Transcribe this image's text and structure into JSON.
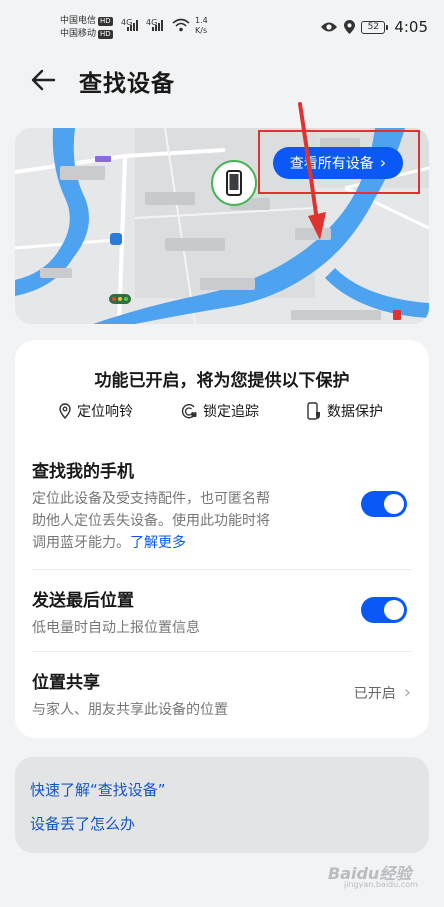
{
  "status_bar": {
    "carrier_1": "中国电信",
    "carrier_2": "中国移动",
    "hd": "HD",
    "network_1": "4G",
    "network_2": "4G",
    "speed_value": "1.4",
    "speed_unit": "K/s",
    "battery": "52",
    "time": "4:05"
  },
  "header": {
    "title": "查找设备"
  },
  "map": {
    "view_all_label": "查看所有设备"
  },
  "protection": {
    "heading": "功能已开启，将为您提供以下保护",
    "features": [
      {
        "label": "定位响铃",
        "icon": "location-pin-icon"
      },
      {
        "label": "锁定追踪",
        "icon": "lock-tracking-icon"
      },
      {
        "label": "数据保护",
        "icon": "phone-shield-icon"
      }
    ]
  },
  "settings": {
    "find_phone": {
      "title": "查找我的手机",
      "desc_line1": "定位此设备及受支持配件，也可匿名帮",
      "desc_line2": "助他人定位丢失设备。使用此功能时将",
      "desc_line3": "调用蓝牙能力。",
      "learn_more": "了解更多",
      "enabled": true
    },
    "last_location": {
      "title": "发送最后位置",
      "desc": "低电量时自动上报位置信息",
      "enabled": true
    },
    "location_sharing": {
      "title": "位置共享",
      "desc": "与家人、朋友共享此设备的位置",
      "state": "已开启"
    }
  },
  "help": {
    "link_1": "快速了解“查找设备”",
    "link_2": "设备丢了怎么办"
  },
  "watermark": {
    "text": "Baidu经验",
    "sub": "jingyan.baidu.com"
  },
  "colors": {
    "accent": "#0a59f7",
    "annotation": "#e0332f",
    "device_ring": "#47b457",
    "river": "#4da3f0"
  }
}
